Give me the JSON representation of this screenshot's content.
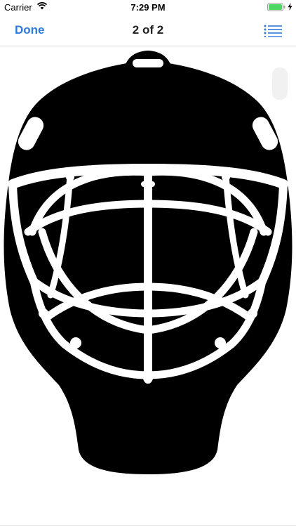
{
  "status_bar": {
    "carrier": "Carrier",
    "time": "7:29 PM",
    "wifi_icon": "wifi-icon",
    "battery_icon": "battery-full-icon",
    "charging_icon": "bolt-icon"
  },
  "nav": {
    "done_label": "Done",
    "title": "2 of 2",
    "list_icon": "list-icon",
    "accent_color": "#2f7ad8"
  },
  "image": {
    "subject_icon": "goalie-mask-icon",
    "colors": {
      "mask": "#000000",
      "cage": "#ffffff",
      "background": "#ffffff"
    }
  }
}
